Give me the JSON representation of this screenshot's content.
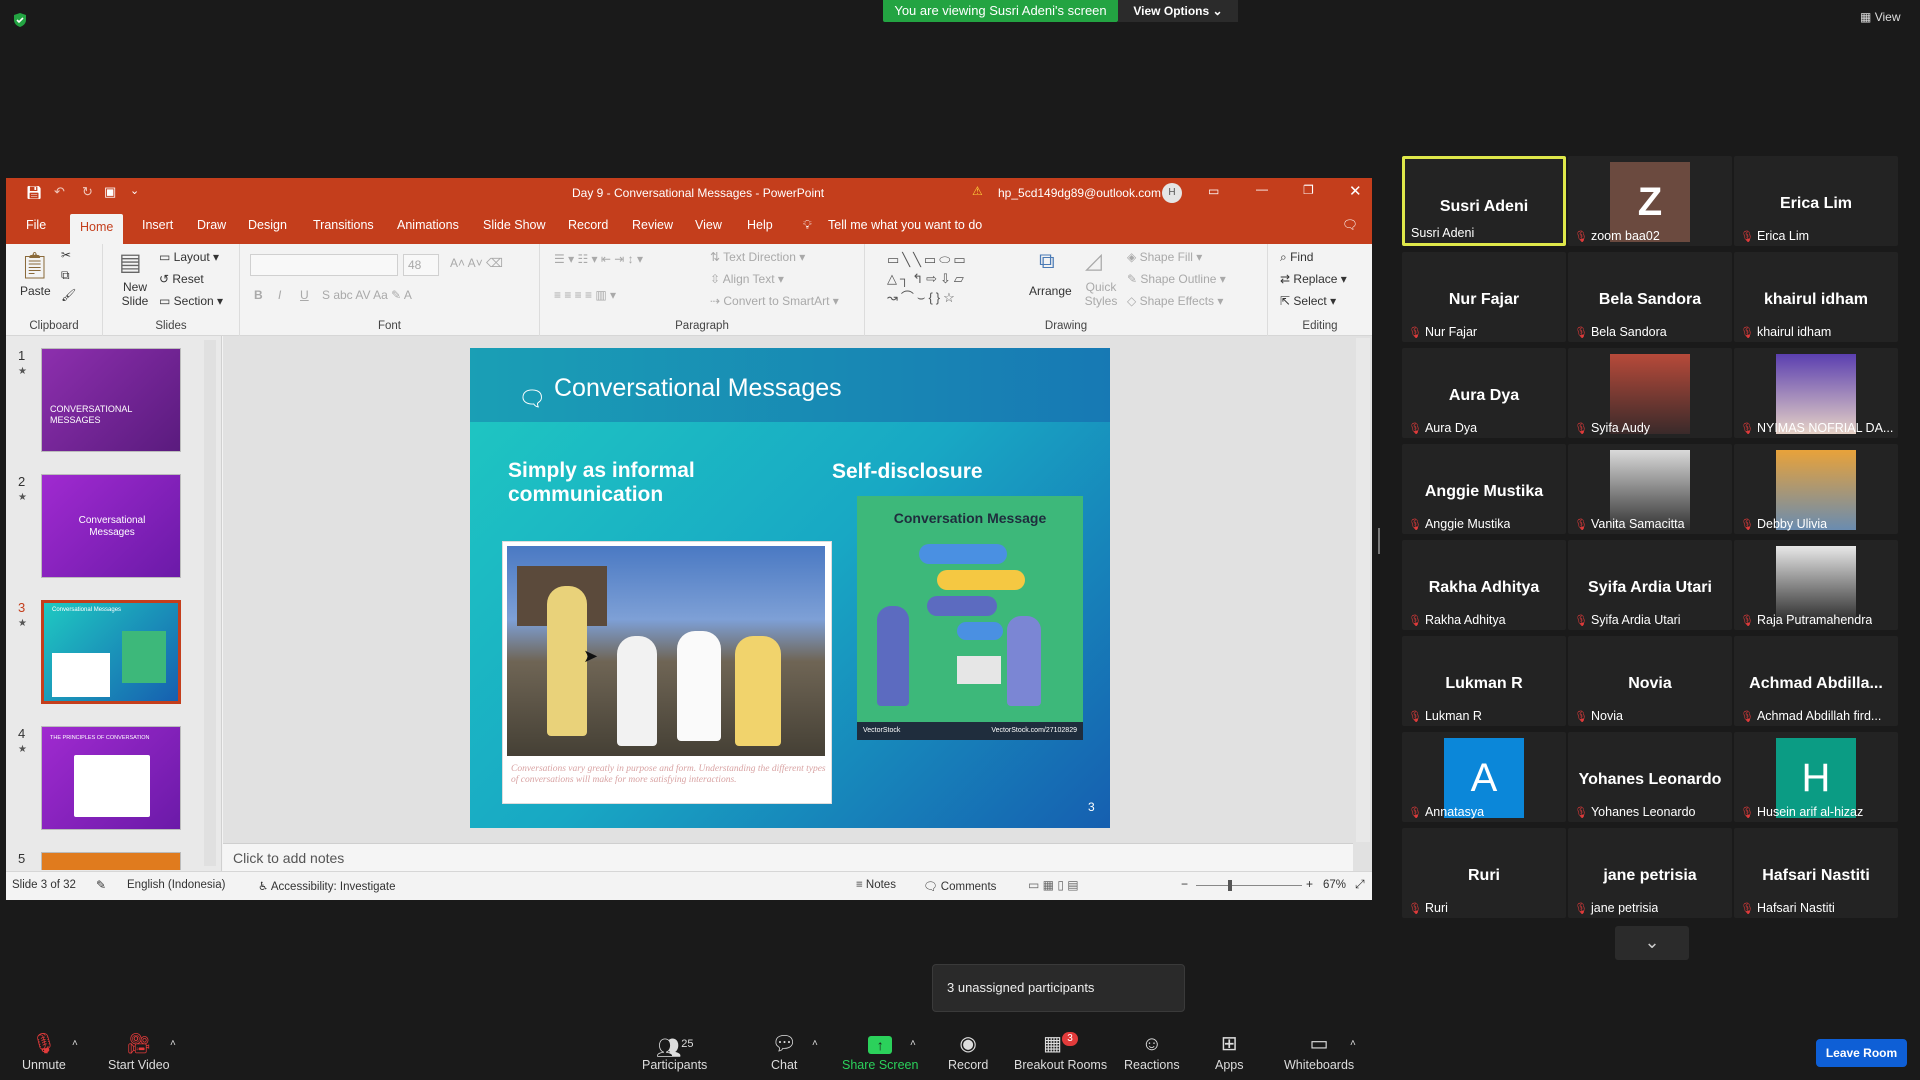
{
  "zoom": {
    "banner_text": "You are viewing Susri Adeni's screen",
    "view_options_label": "View Options",
    "view_label": "View",
    "popup_text": "3 unassigned participants",
    "leave_label": "Leave Room",
    "toolbar": {
      "unmute": "Unmute",
      "start_video": "Start Video",
      "participants": "Participants",
      "participants_count": "25",
      "chat": "Chat",
      "share_screen": "Share Screen",
      "record": "Record",
      "breakout_rooms": "Breakout Rooms",
      "breakout_badge": "3",
      "reactions": "Reactions",
      "apps": "Apps",
      "whiteboards": "Whiteboards"
    },
    "participants": [
      {
        "name": "Susri Adeni",
        "label": "Susri Adeni"
      },
      {
        "name": "Z",
        "label": "zoom baa02"
      },
      {
        "name": "Erica Lim",
        "label": "Erica Lim"
      },
      {
        "name": "Nur Fajar",
        "label": "Nur Fajar"
      },
      {
        "name": "Bela Sandora",
        "label": "Bela Sandora"
      },
      {
        "name": "khairul idham",
        "label": "khairul idham"
      },
      {
        "name": "Aura Dya",
        "label": "Aura Dya"
      },
      {
        "name": "",
        "label": "Syifa Audy"
      },
      {
        "name": "",
        "label": "NYIMAS NOFRIAL DA..."
      },
      {
        "name": "Anggie Mustika",
        "label": "Anggie Mustika"
      },
      {
        "name": "",
        "label": "Vanita Samacitta"
      },
      {
        "name": "",
        "label": "Debby Ulivia"
      },
      {
        "name": "Rakha Adhitya",
        "label": "Rakha Adhitya"
      },
      {
        "name": "Syifa Ardia Utari",
        "label": "Syifa Ardia Utari"
      },
      {
        "name": "",
        "label": "Raja Putramahendra"
      },
      {
        "name": "Lukman R",
        "label": "Lukman R"
      },
      {
        "name": "Novia",
        "label": "Novia"
      },
      {
        "name": "Achmad Abdilla...",
        "label": "Achmad Abdillah fird..."
      },
      {
        "name": "A",
        "label": "Annatasya"
      },
      {
        "name": "Yohanes Leonardo",
        "label": "Yohanes Leonardo"
      },
      {
        "name": "H",
        "label": "Husein arif al-hizaz"
      },
      {
        "name": "Ruri",
        "label": "Ruri"
      },
      {
        "name": "jane petrisia",
        "label": "jane petrisia"
      },
      {
        "name": "Hafsari Nastiti",
        "label": "Hafsari Nastiti"
      }
    ]
  },
  "ppt": {
    "title": "Day 9 - Conversational Messages  -  PowerPoint",
    "account": "hp_5cd149dg89@outlook.com",
    "account_initial": "H",
    "tabs": [
      "File",
      "Home",
      "Insert",
      "Draw",
      "Design",
      "Transitions",
      "Animations",
      "Slide Show",
      "Record",
      "Review",
      "View",
      "Help"
    ],
    "tell_me": "Tell me what you want to do",
    "ribbon": {
      "paste": "Paste",
      "clipboard": "Clipboard",
      "new_slide": "New Slide",
      "layout": "Layout",
      "reset": "Reset",
      "section": "Section",
      "slides": "Slides",
      "font_size": "48",
      "font": "Font",
      "text_direction": "Text Direction",
      "align_text": "Align Text",
      "convert_smartart": "Convert to SmartArt",
      "paragraph": "Paragraph",
      "arrange": "Arrange",
      "quick_styles": "Quick Styles",
      "shape_fill": "Shape Fill",
      "shape_outline": "Shape Outline",
      "shape_effects": "Shape Effects",
      "drawing": "Drawing",
      "find": "Find",
      "replace": "Replace",
      "select": "Select",
      "editing": "Editing"
    },
    "thumbnails": [
      {
        "num": "1",
        "text": "CONVERSATIONAL MESSAGES"
      },
      {
        "num": "2",
        "text": "Conversational Messages"
      },
      {
        "num": "3",
        "text": "Conversational Messages"
      },
      {
        "num": "4",
        "text": "THE PRINCIPLES OF CONVERSATION"
      },
      {
        "num": "5",
        "text": ""
      }
    ],
    "slide": {
      "title": "Conversational Messages",
      "left_heading": "Simply as informal communication",
      "right_heading": "Self-disclosure",
      "caption": "Conversations vary greatly in purpose and form. Understanding the different types of conversations will make for more satisfying interactions.",
      "card_title": "Conversation Message",
      "card_footer": "VectorStock",
      "card_footer_url": "VectorStock.com/27102829",
      "page_number": "3"
    },
    "notes_placeholder": "Click to add notes",
    "status": {
      "slide_of": "Slide 3 of 32",
      "language": "English (Indonesia)",
      "accessibility": "Accessibility: Investigate",
      "notes": "Notes",
      "comments": "Comments",
      "zoom": "67%"
    }
  }
}
